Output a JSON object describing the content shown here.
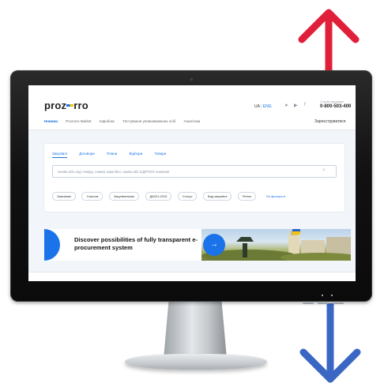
{
  "site": {
    "logo_left": "proz",
    "logo_right": "rro",
    "lang_ua": "UA",
    "lang_sep": "|",
    "lang_eng": "ENG",
    "phone_label": "Служба підтримки",
    "phone": "0-800-503-400",
    "register": "Зареєструватися",
    "nav": [
      "Новини",
      "Prozorro Market",
      "Інфобокс",
      "Тестування уповноважених осіб",
      "Аналітика"
    ],
    "tabs": [
      "Закупівлі",
      "Договори",
      "Плани",
      "Відбори",
      "Товари"
    ],
    "search_placeholder": "Назва або код товару, номер закупівлі, назва або ЄДРПОУ компанії",
    "chips": [
      "Замовник",
      "Учасник",
      "Закупівельник",
      "ДК021:2015",
      "Статус",
      "Вид закупівлі",
      "Регіон"
    ],
    "all_filters": "Усі фільтри ▾",
    "banner_text": "Discover possibilities of fully transparent e-procurement system",
    "banner_arrow": "→",
    "search_icon_glyph": "⌕",
    "social": [
      "➤",
      "▶",
      "f"
    ]
  },
  "colors": {
    "arrow_up": "#e0203a",
    "arrow_down": "#3a67c4",
    "accent": "#1a73e8"
  }
}
